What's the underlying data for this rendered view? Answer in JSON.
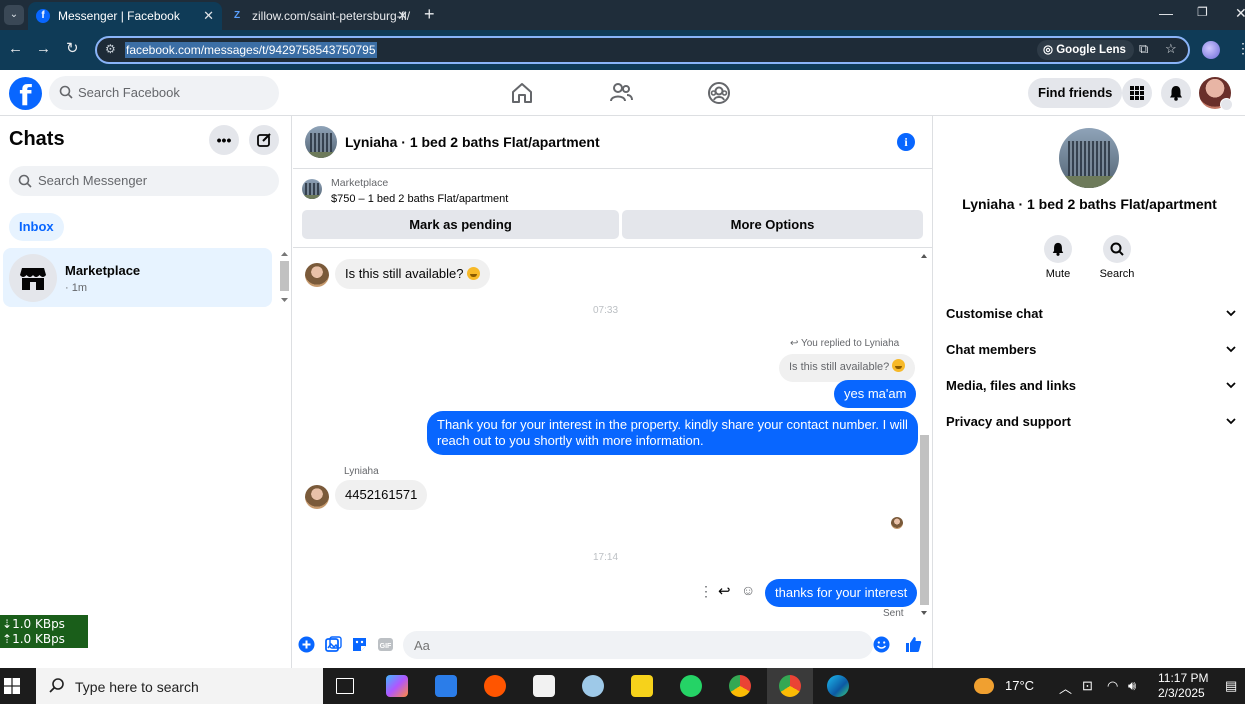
{
  "browser": {
    "tabs": [
      {
        "label": "Messenger | Facebook",
        "active": true
      },
      {
        "label": "zillow.com/saint-petersburg-fl/",
        "active": false
      }
    ],
    "url": "facebook.com/messages/t/9429758543750795",
    "lens_label": "Google Lens"
  },
  "fb_header": {
    "search_placeholder": "Search Facebook",
    "find_friends": "Find friends"
  },
  "chats": {
    "title": "Chats",
    "search_placeholder": "Search Messenger",
    "filter": "Inbox",
    "items": [
      {
        "name": "Marketplace",
        "time": "· 1m"
      }
    ]
  },
  "conversation": {
    "title": "Lyniaha · 1 bed 2 baths Flat/apartment",
    "marketplace_label": "Marketplace",
    "listing": "$750 – 1 bed 2 baths Flat/apartment",
    "mark_pending": "Mark as pending",
    "more_options": "More Options",
    "messages": {
      "m1": "Is this still available?",
      "ts1": "07:33",
      "reply_note": "You replied to Lyniaha",
      "quoted": "Is this still available?",
      "m2": "yes ma'am",
      "m3_line1": "Thank you for your interest in the property.  kindly share your contact number. I will",
      "m3_line2": "reach out to you shortly with more information.",
      "sender": "Lyniaha",
      "m4": "4452161571",
      "ts2": "17:14",
      "m5": "thanks for your interest",
      "status": "Sent"
    },
    "composer_placeholder": "Aa"
  },
  "details": {
    "name": "Lyniaha · 1 bed 2 baths Flat/apartment",
    "actions": [
      {
        "label": "Mute"
      },
      {
        "label": "Search"
      }
    ],
    "menu": [
      "Customise chat",
      "Chat members",
      "Media, files and links",
      "Privacy and support"
    ]
  },
  "netmon": {
    "down": "1.0 KBps",
    "up": "1.0 KBps"
  },
  "taskbar": {
    "search_placeholder": "Type here to search",
    "temperature": "17°C",
    "time": "11:17 PM",
    "date": "2/3/2025"
  }
}
